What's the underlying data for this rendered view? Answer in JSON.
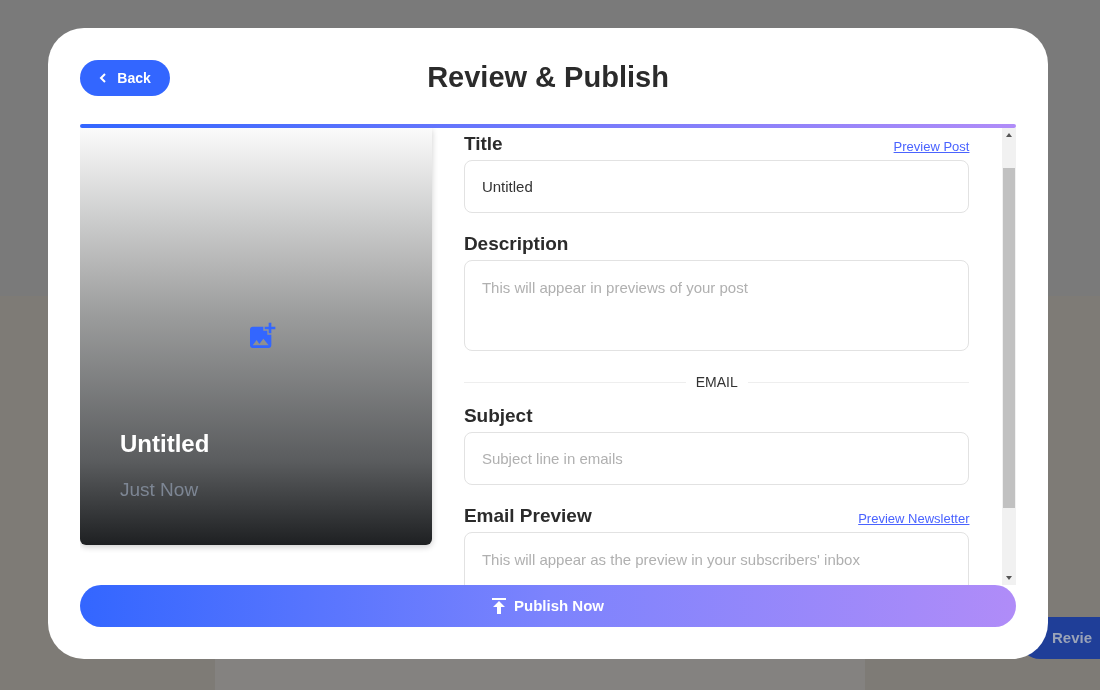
{
  "background_page": {
    "button": "Revie"
  },
  "dialog": {
    "back_button": "Back",
    "title": "Review & Publish",
    "preview_card": {
      "title": "Untitled",
      "time": "Just Now"
    },
    "sections": [
      {
        "kind": "field",
        "label": "Title",
        "link": "Preview Post",
        "value": "Untitled",
        "multiline": false
      },
      {
        "kind": "field",
        "label": "Description",
        "placeholder": "This will appear in previews of your post",
        "multiline": true
      },
      {
        "kind": "divider",
        "label": "EMAIL"
      },
      {
        "kind": "field",
        "label": "Subject",
        "placeholder": "Subject line in emails",
        "multiline": false
      },
      {
        "kind": "field",
        "label": "Email Preview",
        "link": "Preview Newsletter",
        "placeholder": "This will appear as the preview in your subscribers' inbox",
        "multiline": true
      }
    ],
    "publish_button": "Publish Now"
  }
}
